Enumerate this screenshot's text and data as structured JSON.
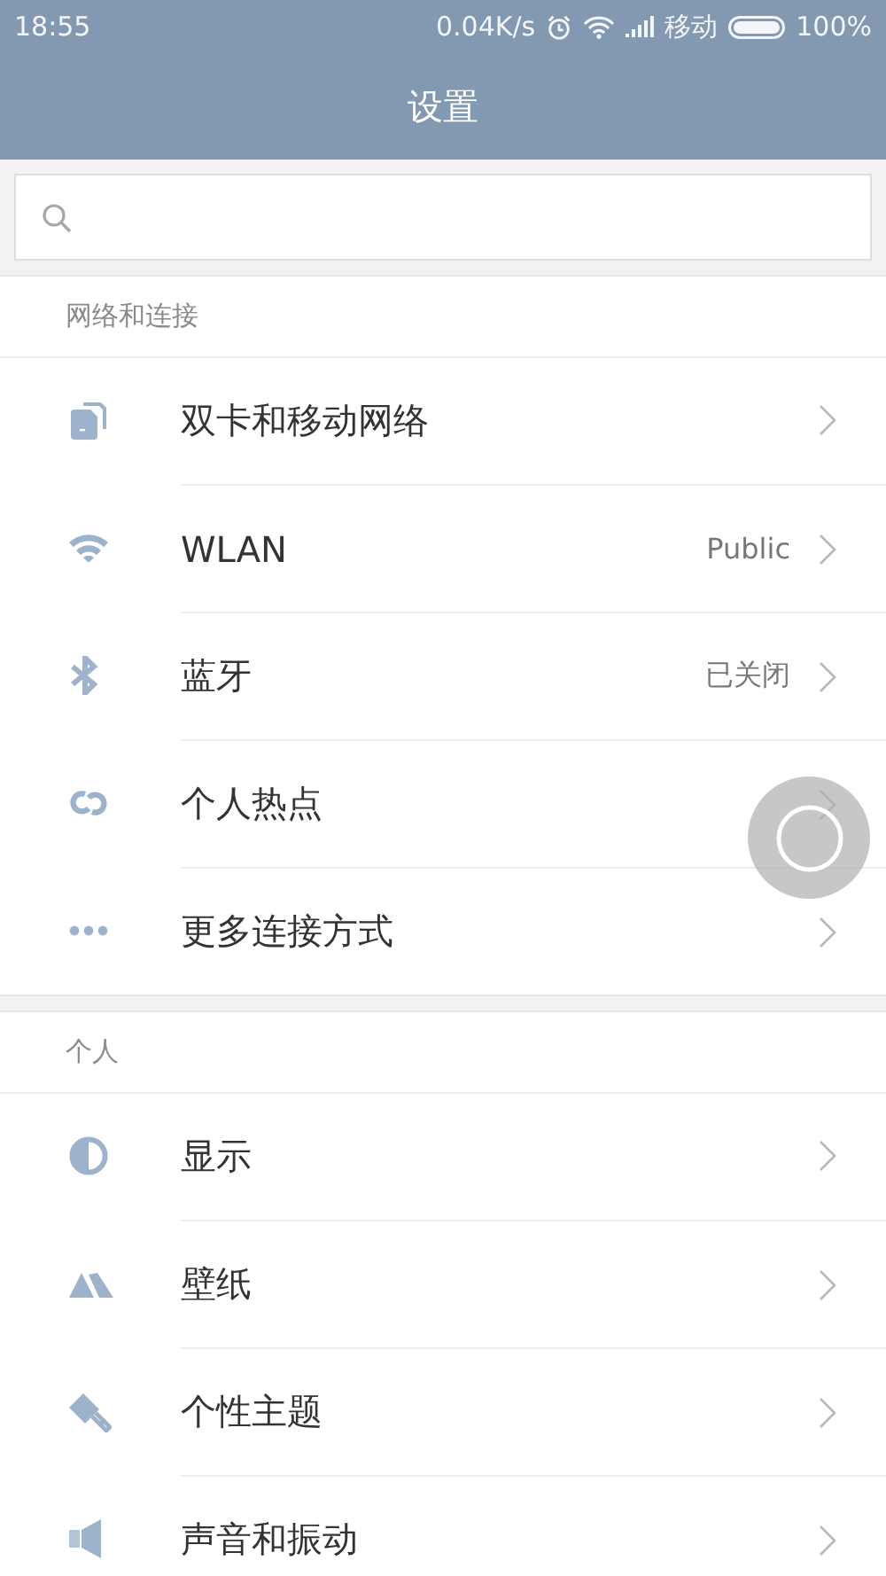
{
  "status_bar": {
    "time": "18:55",
    "speed": "0.04K/s",
    "carrier": "移动",
    "battery": "100%"
  },
  "title": "设置",
  "sections": [
    {
      "header": "网络和连接",
      "items": [
        {
          "label": "双卡和移动网络"
        },
        {
          "label": "WLAN",
          "value": "Public"
        },
        {
          "label": "蓝牙",
          "value": "已关闭"
        },
        {
          "label": "个人热点"
        },
        {
          "label": "更多连接方式"
        }
      ]
    },
    {
      "header": "个人",
      "items": [
        {
          "label": "显示"
        },
        {
          "label": "壁纸"
        },
        {
          "label": "个性主题"
        },
        {
          "label": "声音和振动"
        }
      ]
    }
  ]
}
